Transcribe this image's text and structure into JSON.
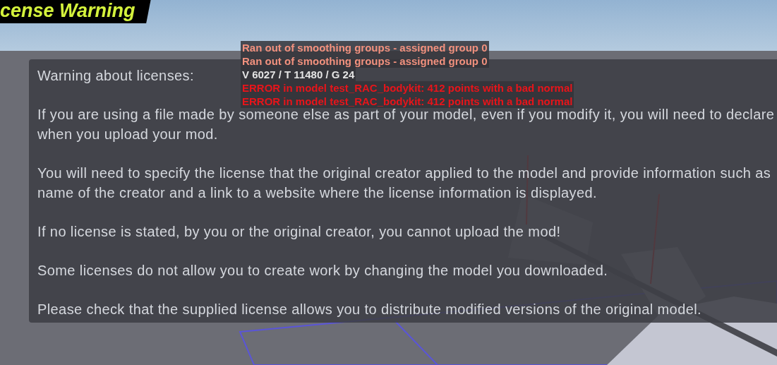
{
  "title": "cense Warning",
  "log": [
    {
      "kind": "warning",
      "text": "Ran out of smoothing groups - assigned group 0"
    },
    {
      "kind": "warning",
      "text": "Ran out of smoothing groups - assigned group 0"
    },
    {
      "kind": "info",
      "text": "V 6027 / T 11480 / G 24"
    },
    {
      "kind": "error",
      "text": "ERROR in model test_RAC_bodykit: 412 points with a bad normal"
    },
    {
      "kind": "error",
      "text": "ERROR in model test_RAC_bodykit: 412 points with a bad normal"
    }
  ],
  "panel": {
    "heading": "Warning about licenses:",
    "paragraphs": [
      "If you are using a file made by someone else as part of your model, even if you modify it, you will need to declare\nwhen you upload your mod.",
      "You will need to specify the license that the original creator applied to the model and provide information such as\nname of the creator and a link to a website where the license information is displayed.",
      "If no license is stated, by you or the original creator, you cannot upload the mod!",
      "Some licenses do not allow you to create work by changing the model you downloaded.",
      "Please check that the supplied license allows you to distribute modified versions of the original model."
    ]
  }
}
